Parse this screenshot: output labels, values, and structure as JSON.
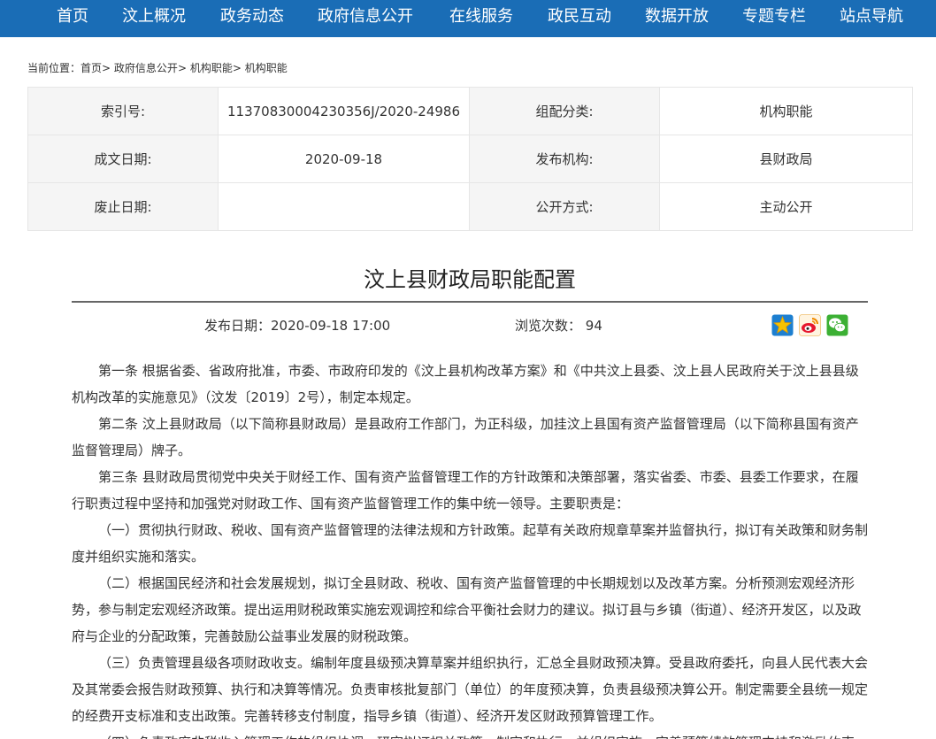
{
  "nav": {
    "items": [
      "首页",
      "汶上概况",
      "政务动态",
      "政府信息公开",
      "在线服务",
      "政民互动",
      "数据开放",
      "专题专栏",
      "站点导航"
    ]
  },
  "breadcrumb": {
    "prefix": "当前位置：",
    "items": [
      "首页",
      "政府信息公开",
      "机构职能",
      "机构职能"
    ],
    "separator": ">"
  },
  "meta": {
    "index_label": "索引号:",
    "index_value": "11370830004230356J/2020-24986",
    "category_label": "组配分类:",
    "category_value": "机构职能",
    "date_label": "成文日期:",
    "date_value": "2020-09-18",
    "publisher_label": "发布机构:",
    "publisher_value": "县财政局",
    "expire_label": "废止日期:",
    "expire_value": "",
    "method_label": "公开方式:",
    "method_value": "主动公开"
  },
  "article": {
    "title": "汶上县财政局职能配置",
    "publish_label": "发布日期：",
    "publish_value": "2020-09-18 17:00",
    "views_label": "浏览次数：",
    "views_value": "94",
    "paragraphs": [
      "第一条 根据省委、省政府批准，市委、市政府印发的《汶上县机构改革方案》和《中共汶上县委、汶上县人民政府关于汶上县县级机构改革的实施意见》（汶发〔2019〕2号），制定本规定。",
      "第二条 汶上县财政局（以下简称县财政局）是县政府工作部门，为正科级，加挂汶上县国有资产监督管理局（以下简称县国有资产监督管理局）牌子。",
      "第三条 县财政局贯彻党中央关于财经工作、国有资产监督管理工作的方针政策和决策部署，落实省委、市委、县委工作要求，在履行职责过程中坚持和加强党对财政工作、国有资产监督管理工作的集中统一领导。主要职责是：",
      "（一）贯彻执行财政、税收、国有资产监督管理的法律法规和方针政策。起草有关政府规章草案并监督执行，拟订有关政策和财务制度并组织实施和落实。",
      "（二）根据国民经济和社会发展规划，拟订全县财政、税收、国有资产监督管理的中长期规划以及改革方案。分析预测宏观经济形势，参与制定宏观经济政策。提出运用财税政策实施宏观调控和综合平衡社会财力的建议。拟订县与乡镇（街道）、经济开发区，以及政府与企业的分配政策，完善鼓励公益事业发展的财税政策。",
      "（三）负责管理县级各项财政收支。编制年度县级预决算草案并组织执行，汇总全县财政预决算。受县政府委托，向县人民代表大会及其常委会报告财政预算、执行和决算等情况。负责审核批复部门（单位）的年度预决算，负责县级预决算公开。制定需要全县统一规定的经费开支标准和支出政策。完善转移支付制度，指导乡镇（街道）、经济开发区财政预算管理工作。",
      "（四）负责政府非税收入管理工作的组织协调，研究拟订相关政策，制定和执行，并组织实施，完善预算绩效管理支持和激励约束。"
    ]
  },
  "share": {
    "icons": [
      "qzone-icon",
      "weibo-icon",
      "wechat-icon"
    ],
    "colors": {
      "qzone": "#f5b800",
      "weibo": "#e6162d",
      "wechat": "#3cb034"
    }
  },
  "colors": {
    "nav_bg": "#1a6db6",
    "table_label_bg": "#f5f5f5",
    "table_border": "#e6e6e6"
  }
}
